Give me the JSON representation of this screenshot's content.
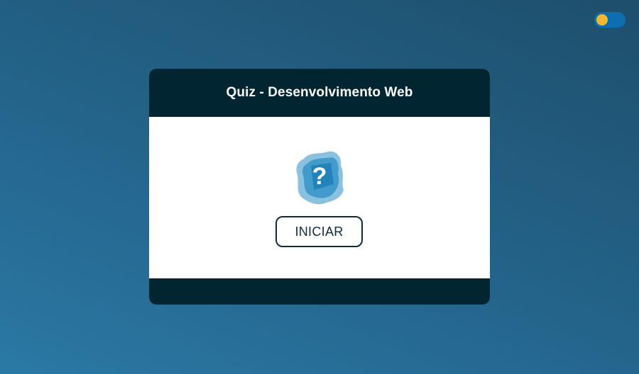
{
  "theme_toggle": {
    "state": "off",
    "track_color": "#0d6eb0",
    "knob_color": "#f1b92e"
  },
  "quiz": {
    "title": "Quiz - Desenvolvimento Web",
    "icon": "question-mark-icon",
    "icon_glyph": "?",
    "start_label": "INICIAR"
  },
  "colors": {
    "header_bg": "#022532",
    "icon_blue": "#2a8ec4",
    "button_border": "#0c2c3a"
  }
}
